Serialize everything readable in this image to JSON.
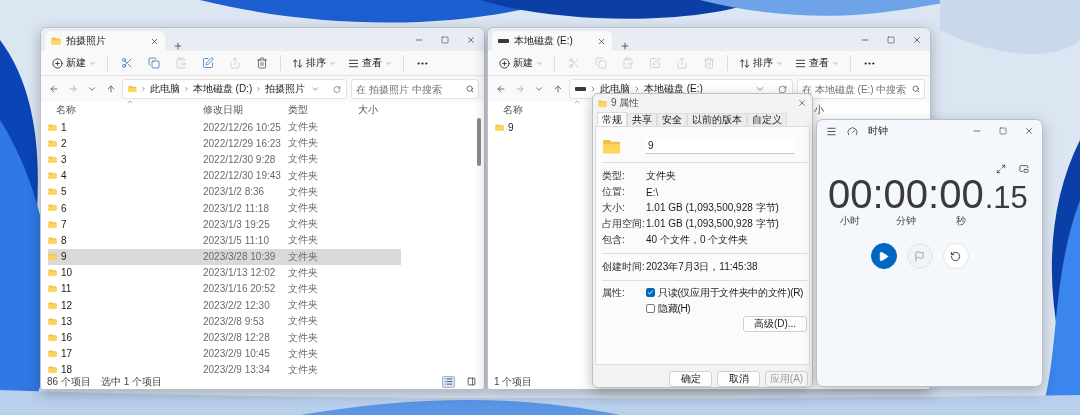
{
  "explorer_windows": [
    {
      "tab": {
        "kind": "folder",
        "title": "拍摄照片"
      },
      "menus": [
        {
          "label": "新建"
        },
        {
          "label": "排序"
        },
        {
          "label": "查看"
        }
      ],
      "toolbar_icons": [
        {
          "disabled": false
        },
        {
          "disabled": false
        },
        {
          "disabled": true
        },
        {
          "disabled": false
        },
        {
          "disabled": true
        },
        {
          "disabled": false
        }
      ],
      "crumbs": [
        "此电脑",
        "本地磁盘 (D:)",
        "拍摄照片"
      ],
      "search": {
        "placeholder": "在 拍摄照片 中搜索"
      },
      "columns": [
        {
          "label": "名称"
        },
        {
          "label": "修改日期"
        },
        {
          "label": "类型"
        },
        {
          "label": "大小"
        }
      ],
      "rows": [
        {
          "name": "1",
          "modified": "2022/12/26 10:25",
          "type": "文件夹",
          "selected": false
        },
        {
          "name": "2",
          "modified": "2022/12/29 16:23",
          "type": "文件夹",
          "selected": false
        },
        {
          "name": "3",
          "modified": "2022/12/30 9:28",
          "type": "文件夹",
          "selected": false
        },
        {
          "name": "4",
          "modified": "2022/12/30 19:43",
          "type": "文件夹",
          "selected": false
        },
        {
          "name": "5",
          "modified": "2023/1/2 8:36",
          "type": "文件夹",
          "selected": false
        },
        {
          "name": "6",
          "modified": "2023/1/2 11:18",
          "type": "文件夹",
          "selected": false
        },
        {
          "name": "7",
          "modified": "2023/1/3 19:25",
          "type": "文件夹",
          "selected": false
        },
        {
          "name": "8",
          "modified": "2023/1/5 11:10",
          "type": "文件夹",
          "selected": false
        },
        {
          "name": "9",
          "modified": "2023/3/28 10:39",
          "type": "文件夹",
          "selected": true
        },
        {
          "name": "10",
          "modified": "2023/1/13 12:02",
          "type": "文件夹",
          "selected": false
        },
        {
          "name": "11",
          "modified": "2023/1/16 20:52",
          "type": "文件夹",
          "selected": false
        },
        {
          "name": "12",
          "modified": "2023/2/2 12:30",
          "type": "文件夹",
          "selected": false
        },
        {
          "name": "13",
          "modified": "2023/2/8 9:53",
          "type": "文件夹",
          "selected": false
        },
        {
          "name": "16",
          "modified": "2023/2/8 12:28",
          "type": "文件夹",
          "selected": false
        },
        {
          "name": "17",
          "modified": "2023/2/9 10:45",
          "type": "文件夹",
          "selected": false
        },
        {
          "name": "18",
          "modified": "2023/2/9 13:34",
          "type": "文件夹",
          "selected": false
        }
      ],
      "scrollbar": true,
      "status": [
        "86 个项目",
        "选中 1 个项目"
      ],
      "view_buttons": [
        {
          "selected": true
        },
        {
          "selected": false
        }
      ]
    },
    {
      "tab": {
        "kind": "drive",
        "title": "本地磁盘 (E:)"
      },
      "menus": [
        {
          "label": "新建"
        },
        {
          "label": "排序"
        },
        {
          "label": "查看"
        }
      ],
      "toolbar_icons": [
        {
          "disabled": true
        },
        {
          "disabled": true
        },
        {
          "disabled": true
        },
        {
          "disabled": true
        },
        {
          "disabled": true
        },
        {
          "disabled": true
        }
      ],
      "crumbs": [
        "此电脑",
        "本地磁盘 (E:)"
      ],
      "search": {
        "placeholder": "在 本地磁盘 (E:) 中搜索"
      },
      "columns": [
        {
          "label": "名称"
        },
        {
          "label": "小"
        }
      ],
      "rows": [
        {
          "name": "9",
          "selected": false
        }
      ],
      "scrollbar": false,
      "status": [
        "1 个项目"
      ]
    }
  ],
  "properties_dialog": {
    "title": "9 属性",
    "tabs": [
      {
        "label": "常规",
        "selected": true
      },
      {
        "label": "共享",
        "selected": false
      },
      {
        "label": "安全",
        "selected": false
      },
      {
        "label": "以前的版本",
        "selected": false
      },
      {
        "label": "自定义",
        "selected": false
      }
    ],
    "name_value": "9",
    "sections": [
      [
        {
          "label": "类型:",
          "value": "文件夹"
        },
        {
          "label": "位置:",
          "value": "E:\\"
        },
        {
          "label": "大小:",
          "value": "1.01 GB (1,093,500,928 字节)"
        },
        {
          "label": "占用空间:",
          "value": "1.01 GB (1,093,500,928 字节)"
        },
        {
          "label": "包含:",
          "value": "40 个文件，0 个文件夹"
        }
      ],
      [
        {
          "label": "创建时间:",
          "value": "2023年7月3日，11:45:38"
        }
      ]
    ],
    "attributes_label": "属性:",
    "checkboxes": [
      {
        "label": "只读(仅应用于文件夹中的文件)(R)",
        "checked": true
      },
      {
        "label": "隐藏(H)",
        "checked": false
      }
    ],
    "advanced_button": "高级(D)...",
    "buttons": [
      {
        "label": "确定",
        "disabled": false
      },
      {
        "label": "取消",
        "disabled": false
      },
      {
        "label": "应用(A)",
        "disabled": true
      }
    ]
  },
  "clock": {
    "title": "时钟",
    "time": "00:00:00",
    "fraction": ".15",
    "units": [
      "小时",
      "分钟",
      "秒"
    ],
    "controls": [
      {
        "disabled": false
      },
      {
        "disabled": true
      },
      {
        "disabled": false
      }
    ]
  }
}
